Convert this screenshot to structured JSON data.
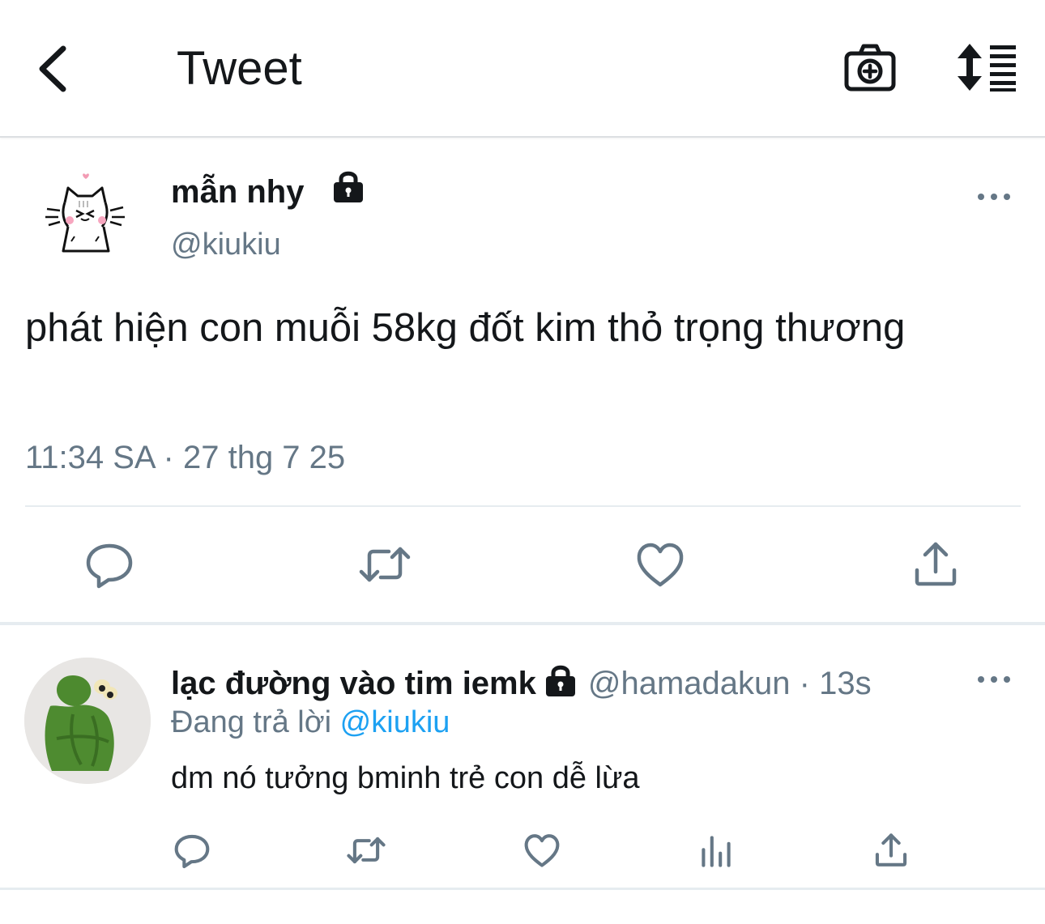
{
  "header": {
    "title": "Tweet",
    "icons": [
      "back-arrow-icon",
      "camera-plus-icon",
      "sort-list-icon"
    ]
  },
  "tweet": {
    "author_name": "mẫn nhy",
    "author_handle": "@kiukiu",
    "protected_icon": "lock-icon",
    "text": "phát hiện con muỗi 58kg đốt kim thỏ trọng thương",
    "time": "11:34 SA",
    "separator": "·",
    "date": "27 thg 7 25",
    "actions": [
      "reply-icon",
      "retweet-icon",
      "like-icon",
      "share-icon"
    ]
  },
  "reply": {
    "author_name": "lạc đường vào tim iemk",
    "author_handle": "@hamadakun",
    "separator": "·",
    "time_ago": "13s",
    "replying_prefix": "Đang trả lời",
    "replying_to": "@kiukiu",
    "text": "dm nó tưởng bminh trẻ con dễ lừa",
    "actions": [
      "reply-icon",
      "retweet-icon",
      "like-icon",
      "analytics-icon",
      "share-icon"
    ]
  },
  "colors": {
    "text_primary": "#14171a",
    "text_secondary": "#657786",
    "accent_link": "#1da1f2",
    "divider": "#e6ecf0",
    "background": "#ffffff"
  }
}
